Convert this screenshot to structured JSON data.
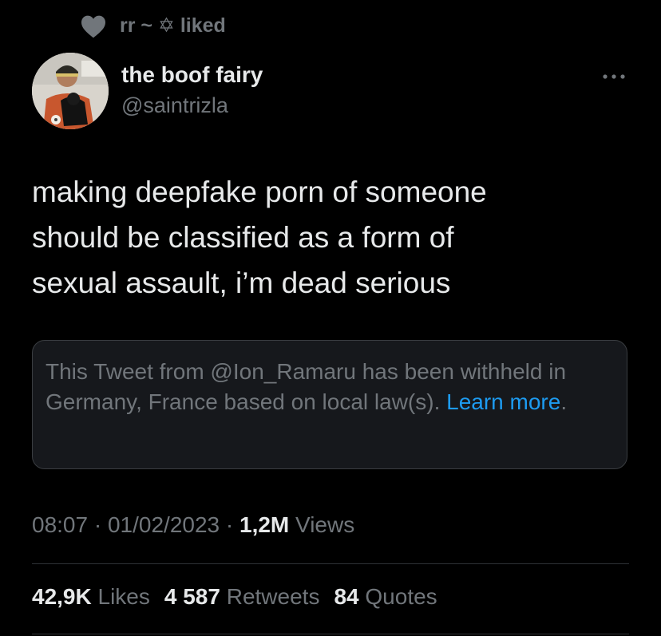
{
  "social_context": {
    "icon": "heart-icon",
    "text": "rr ~ ✡ liked"
  },
  "author": {
    "avatar_icon": "avatar",
    "display_name": "the boof fairy",
    "handle": "@saintrizla"
  },
  "more_icon": "more-icon",
  "tweet": {
    "text": "making deepfake porn of someone\nshould be classified as a form of\nsexual assault, i’m dead serious"
  },
  "withheld_notice": {
    "text": "This Tweet from @Ion_Ramaru has been withheld in Germany, France based on local law(s). ",
    "link_label": "Learn more",
    "trailing": "."
  },
  "meta": {
    "time": "08:07",
    "sep1": " · ",
    "date": "01/02/2023",
    "sep2": " · ",
    "views_count": "1,2M",
    "views_label": " Views"
  },
  "stats": {
    "likes_count": "42,9K",
    "likes_label": " Likes",
    "retweets_count": "4 587",
    "retweets_label": " Retweets",
    "quotes_count": "84",
    "quotes_label": " Quotes"
  },
  "colors": {
    "background": "#000000",
    "primary_text": "#e7e9ea",
    "secondary_text": "#71767b",
    "link": "#1d9bf0",
    "box_bg": "#16181c",
    "border": "#2f3336"
  }
}
